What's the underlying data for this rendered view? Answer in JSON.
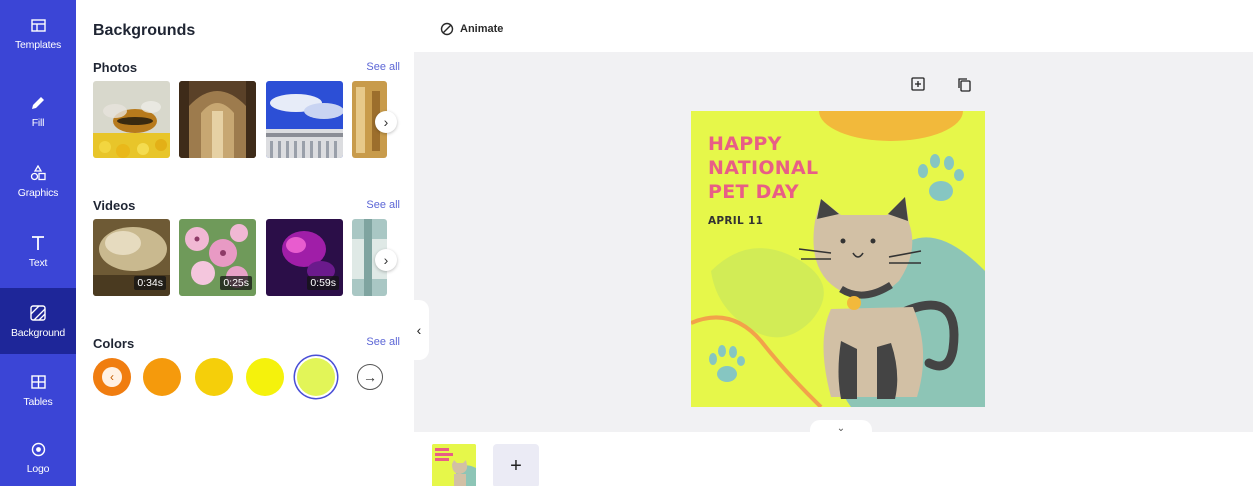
{
  "rail": {
    "items": [
      {
        "label": "Templates",
        "icon": "templates-icon"
      },
      {
        "label": "Fill",
        "icon": "pencil-icon"
      },
      {
        "label": "Graphics",
        "icon": "shapes-icon"
      },
      {
        "label": "Text",
        "icon": "text-icon"
      },
      {
        "label": "Background",
        "icon": "background-icon",
        "active": true
      },
      {
        "label": "Tables",
        "icon": "table-icon"
      },
      {
        "label": "Logo",
        "icon": "logo-icon"
      }
    ]
  },
  "panel": {
    "title": "Backgrounds",
    "photos": {
      "title": "Photos",
      "see_all": "See all"
    },
    "videos": {
      "title": "Videos",
      "see_all": "See all",
      "durations": [
        "0:34s",
        "0:25s",
        "0:59s"
      ]
    },
    "colors": {
      "title": "Colors",
      "see_all": "See all",
      "swatches": [
        "#f59a0c",
        "#f5cf0a",
        "#f5f20c",
        "#e2f558"
      ],
      "selected": "#e2f558"
    }
  },
  "toolbar": {
    "animate_label": "Animate"
  },
  "design": {
    "title_lines": [
      "HAPPY",
      "NATIONAL",
      "PET DAY"
    ],
    "date": "APRIL 11",
    "background_color": "#e6f74a",
    "title_color": "#e85e86"
  },
  "pages": {
    "add_label": "+"
  }
}
